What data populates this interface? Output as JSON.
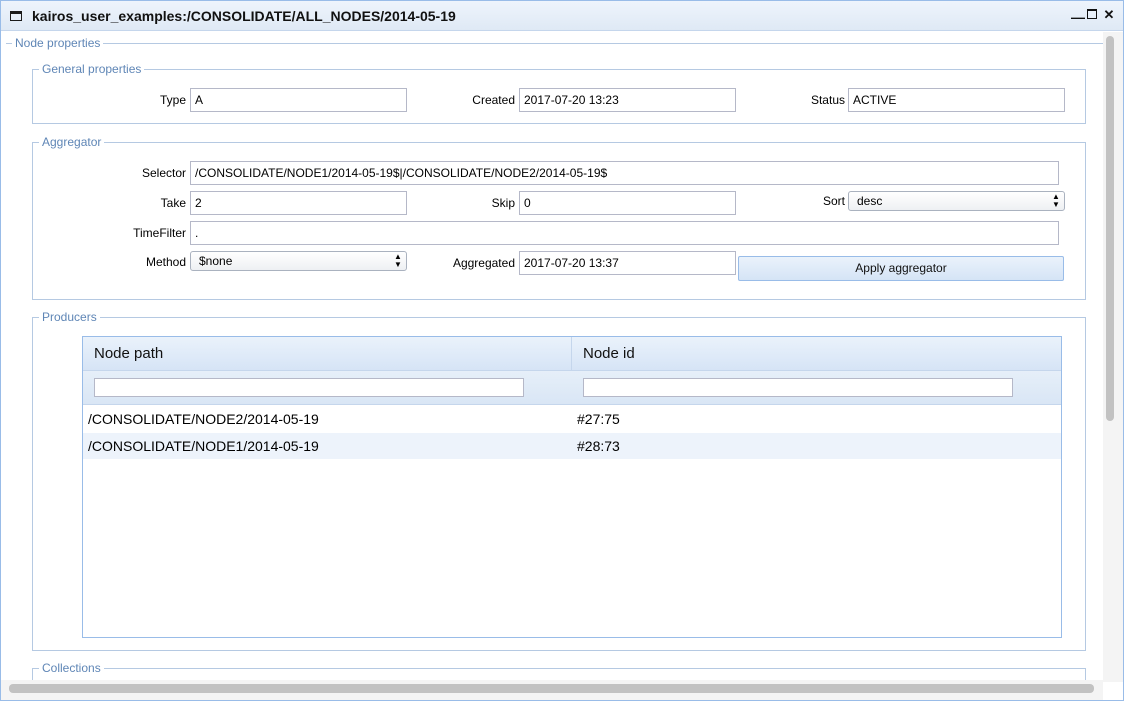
{
  "window": {
    "title": "kairos_user_examples:/CONSOLIDATE/ALL_NODES/2014-05-19",
    "icon": "window-icon"
  },
  "sections": {
    "node_properties": "Node properties",
    "general_properties": "General properties",
    "aggregator": "Aggregator",
    "producers": "Producers",
    "collections": "Collections"
  },
  "general": {
    "type_label": "Type",
    "type_value": "A",
    "created_label": "Created",
    "created_value": "2017-07-20 13:23",
    "status_label": "Status",
    "status_value": "ACTIVE"
  },
  "aggregator": {
    "selector_label": "Selector",
    "selector_value": "/CONSOLIDATE/NODE1/2014-05-19$|/CONSOLIDATE/NODE2/2014-05-19$",
    "take_label": "Take",
    "take_value": "2",
    "skip_label": "Skip",
    "skip_value": "0",
    "sort_label": "Sort",
    "sort_value": "desc",
    "timefilter_label": "TimeFilter",
    "timefilter_value": ".",
    "method_label": "Method",
    "method_value": "$none",
    "aggregated_label": "Aggregated",
    "aggregated_value": "2017-07-20 13:37",
    "apply_button": "Apply aggregator"
  },
  "producers": {
    "columns": [
      "Node path",
      "Node id"
    ],
    "rows": [
      {
        "path": "/CONSOLIDATE/NODE2/2014-05-19",
        "id": "#27:75"
      },
      {
        "path": "/CONSOLIDATE/NODE1/2014-05-19",
        "id": "#28:73"
      }
    ]
  },
  "colors": {
    "accent": "#99bce8",
    "legend": "#5f86b6",
    "row_alt": "#edf3fb"
  }
}
